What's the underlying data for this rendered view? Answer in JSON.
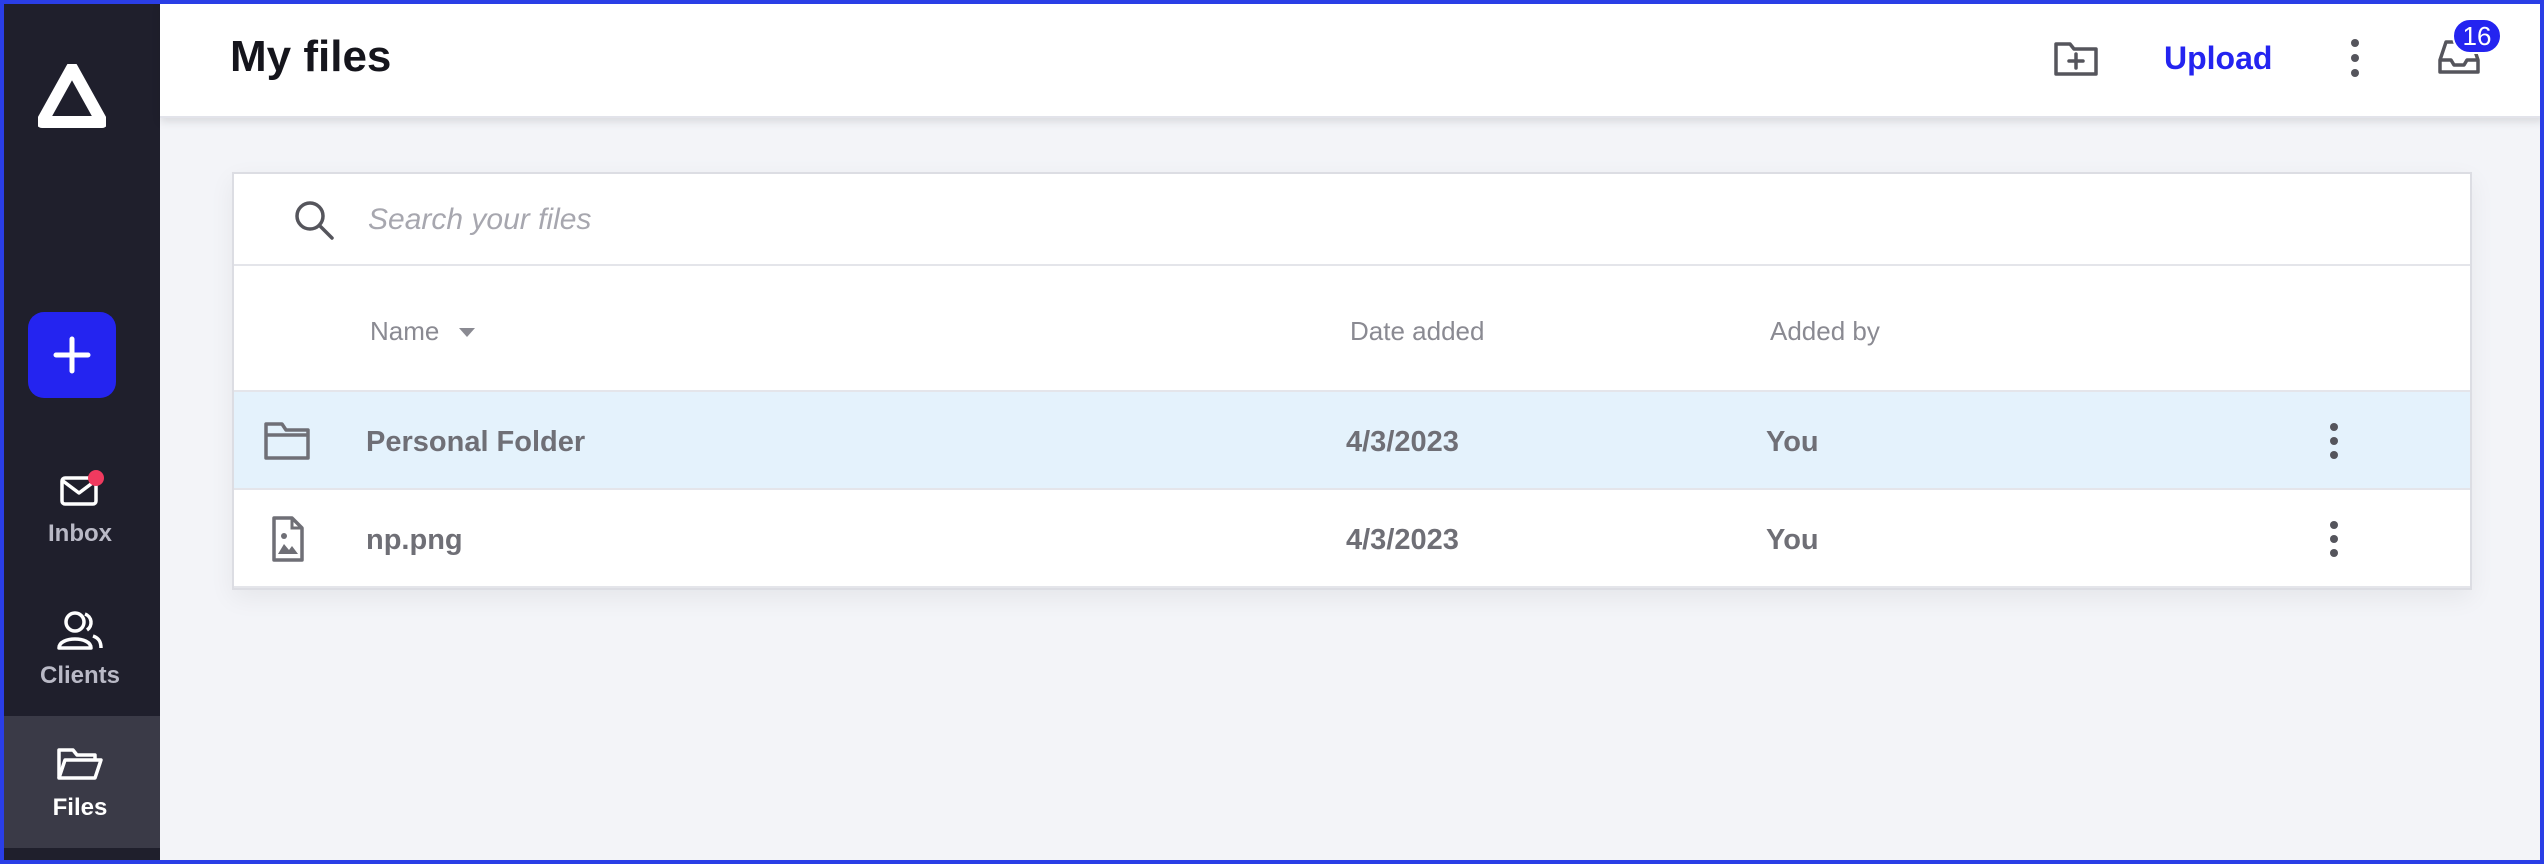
{
  "sidebar": {
    "add_label": "+",
    "items": [
      {
        "label": "Inbox",
        "icon": "mail-icon",
        "has_notification": true
      },
      {
        "label": "Clients",
        "icon": "users-icon"
      },
      {
        "label": "Files",
        "icon": "folder-open-icon",
        "active": true
      }
    ]
  },
  "header": {
    "title": "My files",
    "upload_label": "Upload",
    "inbox_badge": "16"
  },
  "search": {
    "placeholder": "Search your files",
    "value": ""
  },
  "table": {
    "columns": {
      "name": "Name",
      "date": "Date added",
      "added_by": "Added by"
    },
    "rows": [
      {
        "name": "Personal Folder",
        "date": "4/3/2023",
        "added_by": "You",
        "type": "folder",
        "selected": true
      },
      {
        "name": "np.png",
        "date": "4/3/2023",
        "added_by": "You",
        "type": "image"
      }
    ]
  },
  "colors": {
    "accent": "#2424f0",
    "sidebar_bg": "#1f1f2c",
    "selected_row": "#e4f2fc",
    "notification": "#f03a5f"
  }
}
